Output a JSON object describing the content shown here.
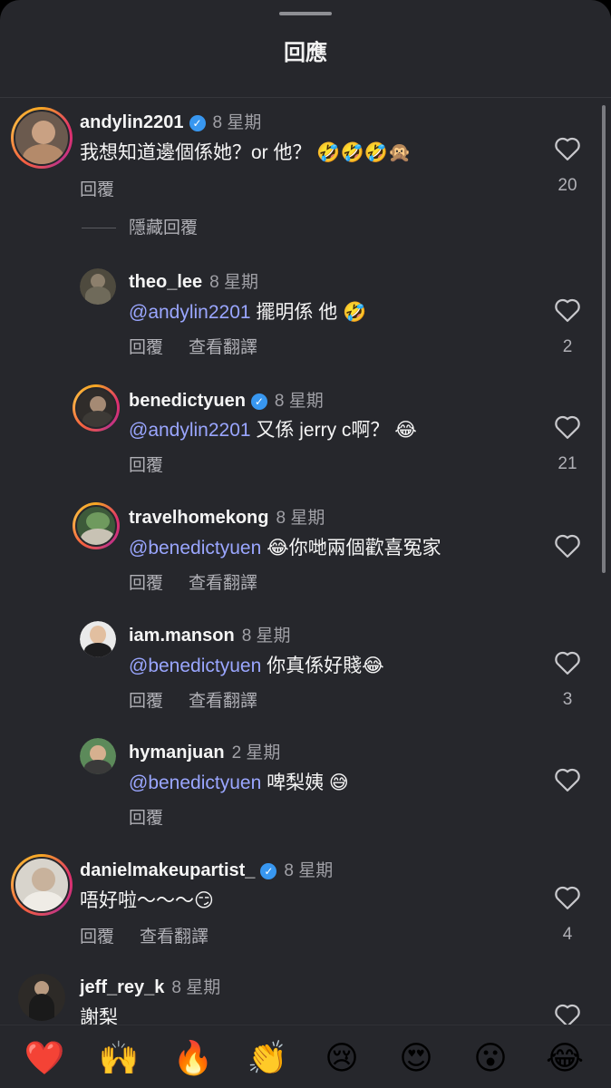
{
  "header": {
    "title": "回應"
  },
  "hide_replies_label": "隱藏回覆",
  "comments": [
    {
      "username": "andylin2201",
      "verified": true,
      "time": "8 星期",
      "text": "我想知道邊個係她？or 他？ 🤣🤣🤣🙊",
      "reply": "回覆",
      "likes": "20"
    },
    {
      "username": "theo_lee",
      "verified": false,
      "time": "8 星期",
      "mention": "@andylin2201",
      "text": " 擺明係 他 🤣",
      "reply": "回覆",
      "translate": "查看翻譯",
      "likes": "2"
    },
    {
      "username": "benedictyuen",
      "verified": true,
      "time": "8 星期",
      "mention": "@andylin2201",
      "text": " 又係 jerry c啊？ 😂",
      "reply": "回覆",
      "likes": "21"
    },
    {
      "username": "travelhomekong",
      "verified": false,
      "time": "8 星期",
      "mention": "@benedictyuen",
      "text": " 😂你哋兩個歡喜冤家",
      "reply": "回覆",
      "translate": "查看翻譯",
      "likes": ""
    },
    {
      "username": "iam.manson",
      "verified": false,
      "time": "8 星期",
      "mention": "@benedictyuen",
      "text": " 你真係好賤😂",
      "reply": "回覆",
      "translate": "查看翻譯",
      "likes": "3"
    },
    {
      "username": "hymanjuan",
      "verified": false,
      "time": "2 星期",
      "mention": "@benedictyuen",
      "text": " 啤梨姨 😅",
      "reply": "回覆",
      "likes": ""
    },
    {
      "username": "danielmakeupartist_",
      "verified": true,
      "time": "8 星期",
      "text": "唔好啦～～～😏",
      "reply": "回覆",
      "translate": "查看翻譯",
      "likes": "4"
    },
    {
      "username": "jeff_rey_k",
      "verified": false,
      "time": "8 星期",
      "text": "謝梨",
      "likes": ""
    }
  ],
  "emoji_bar": [
    "❤️",
    "🙌",
    "🔥",
    "👏",
    "😢",
    "😍",
    "😮",
    "😂"
  ],
  "icons": {
    "heart": "heart-outline-icon",
    "verified": "verified-badge-icon"
  }
}
